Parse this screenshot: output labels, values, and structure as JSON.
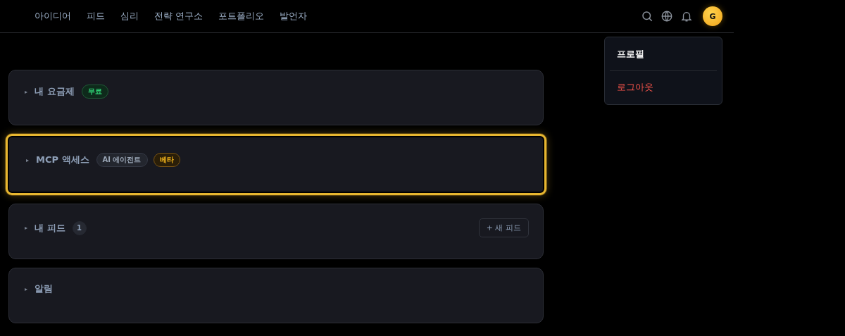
{
  "nav": {
    "items": [
      {
        "label": "아이디어"
      },
      {
        "label": "피드"
      },
      {
        "label": "심리"
      },
      {
        "label": "전략 연구소"
      },
      {
        "label": "포트폴리오"
      },
      {
        "label": "발언자"
      }
    ],
    "avatar": "G"
  },
  "profile_menu": {
    "items": [
      {
        "label": "프로필",
        "kind": "normal"
      },
      {
        "label": "로그아웃",
        "kind": "danger"
      }
    ]
  },
  "sections": [
    {
      "marker": "▸",
      "title": "내 요금제",
      "highlighted": false,
      "badges": [
        {
          "text": "무료",
          "kind": "green"
        }
      ]
    },
    {
      "marker": "▸",
      "title": "MCP 액세스",
      "highlighted": true,
      "badges": [
        {
          "text": "AI 에이전트",
          "kind": "neutral"
        },
        {
          "text": "베타",
          "kind": "gold"
        }
      ]
    },
    {
      "marker": "▸",
      "title": "내 피드",
      "highlighted": false,
      "badges": [
        {
          "text": "1",
          "kind": "count"
        }
      ],
      "action": "+ 새 피드"
    },
    {
      "marker": "▸",
      "title": "알림",
      "highlighted": false
    }
  ]
}
